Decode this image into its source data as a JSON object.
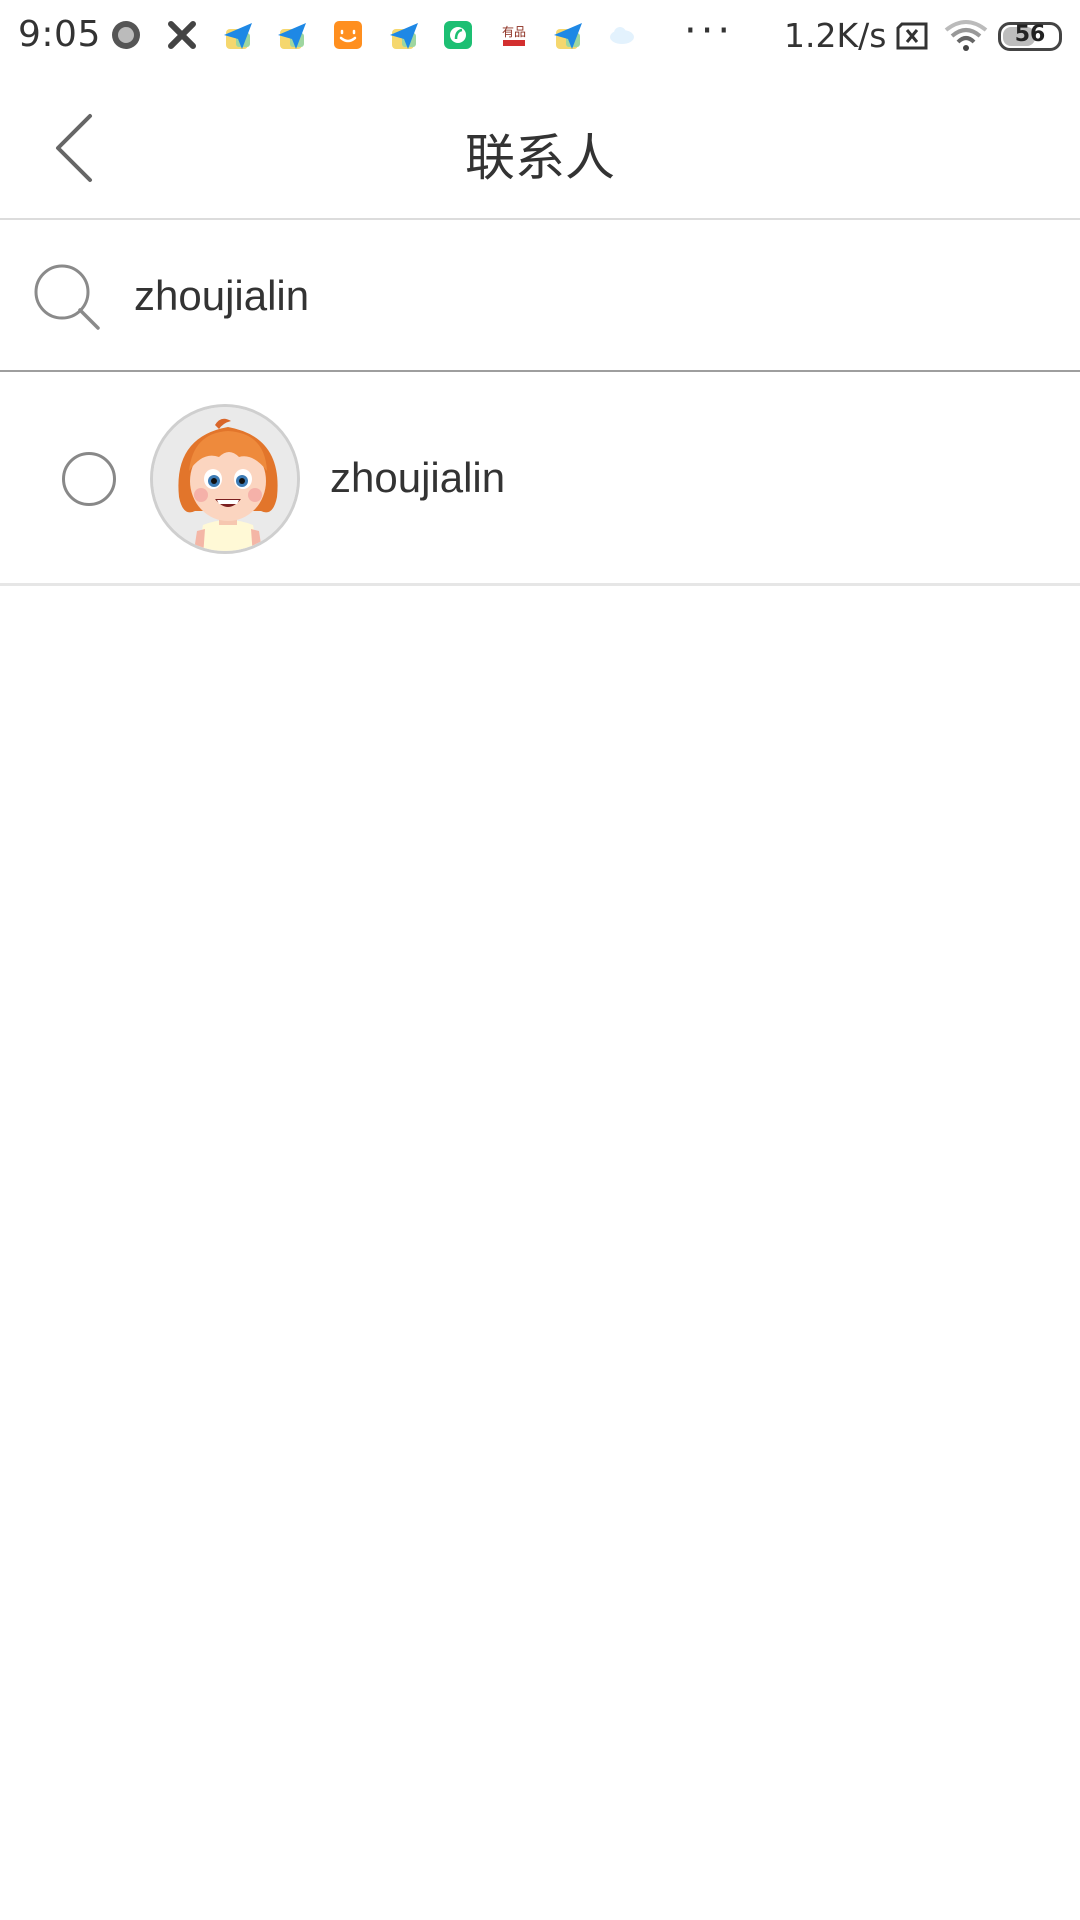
{
  "status_bar": {
    "time": "9:05",
    "more": "···",
    "net_speed": "1.2K/s",
    "battery": "56",
    "icons": [
      "record-icon",
      "close-x-icon",
      "send-app-icon",
      "send-app-icon",
      "taobao-icon",
      "send-app-icon",
      "wechat-like-icon",
      "youpin-icon",
      "send-app-icon",
      "cloud-icon",
      "sim-x-icon",
      "wifi-icon",
      "battery-icon"
    ]
  },
  "header": {
    "title": "联系人",
    "back_icon": "chevron-left-icon"
  },
  "search": {
    "value": "zhoujialin",
    "icon": "search-icon"
  },
  "contacts": [
    {
      "name": "zhoujialin",
      "selected": false,
      "avatar": "cartoon-girl-avatar"
    }
  ],
  "colors": {
    "text": "#333333",
    "divider": "#dcdcdc",
    "radio_border": "#888888"
  }
}
